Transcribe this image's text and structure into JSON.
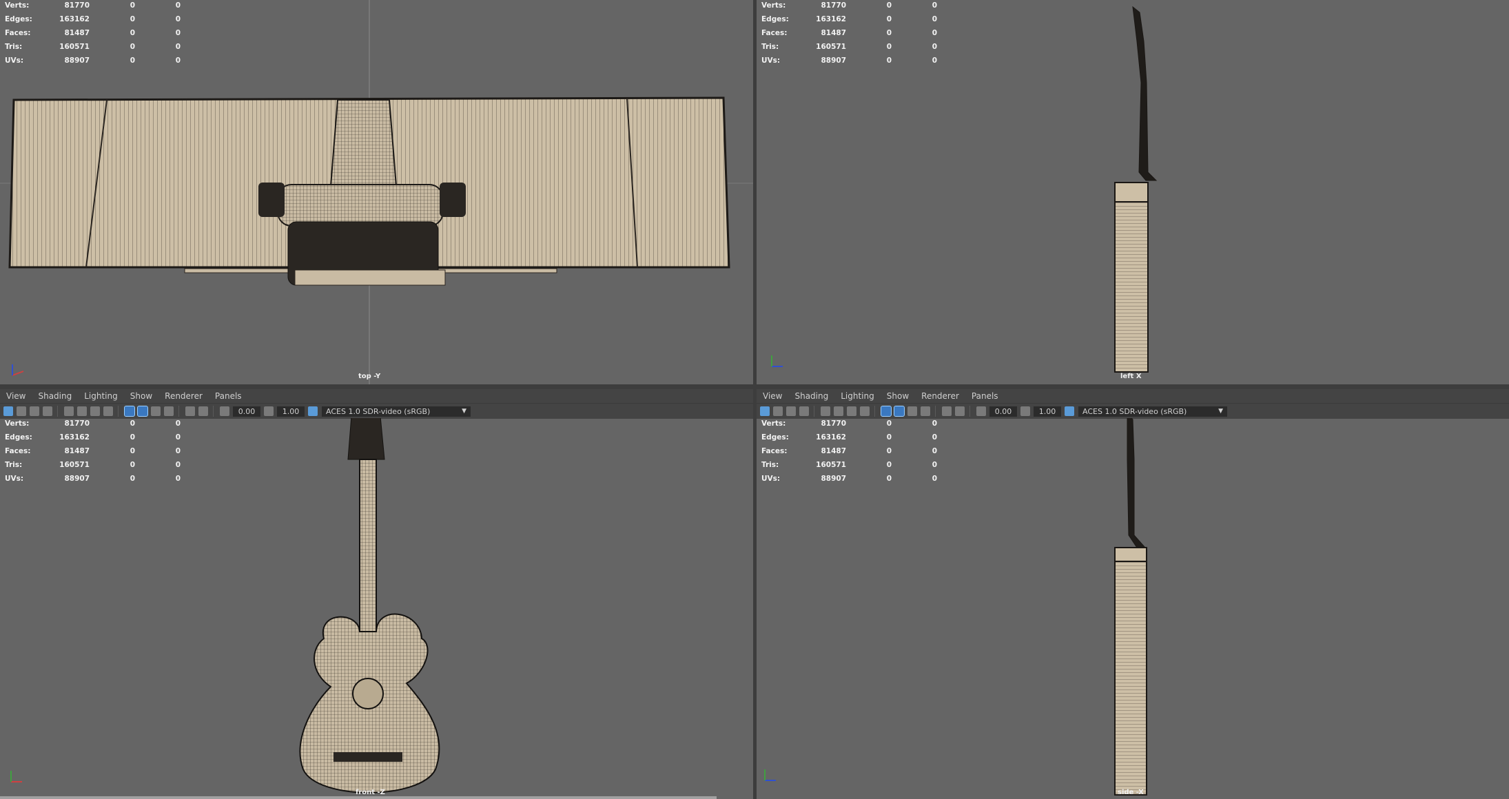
{
  "menu": [
    "View",
    "Shading",
    "Lighting",
    "Show",
    "Renderer",
    "Panels"
  ],
  "toolbar": {
    "field1": "0.00",
    "field2": "1.00",
    "colorspace": "ACES 1.0 SDR-video (sRGB)"
  },
  "hud": {
    "rows": [
      {
        "label": "Verts:",
        "v1": "81770",
        "v2": "0",
        "v3": "0"
      },
      {
        "label": "Edges:",
        "v1": "163162",
        "v2": "0",
        "v3": "0"
      },
      {
        "label": "Faces:",
        "v1": "81487",
        "v2": "0",
        "v3": "0"
      },
      {
        "label": "Tris:",
        "v1": "160571",
        "v2": "0",
        "v3": "0"
      },
      {
        "label": "UVs:",
        "v1": "88907",
        "v2": "0",
        "v3": "0"
      }
    ]
  },
  "cameras": {
    "top": "top -Y",
    "left": "left X",
    "front": "front -Z",
    "side": "side -X"
  },
  "colors": {
    "viewport_bg": "#656565",
    "panel_bar": "#444444",
    "mesh_fill": "#c9bba3",
    "wire": "#2a2520",
    "accent": "#5a9bd8"
  }
}
